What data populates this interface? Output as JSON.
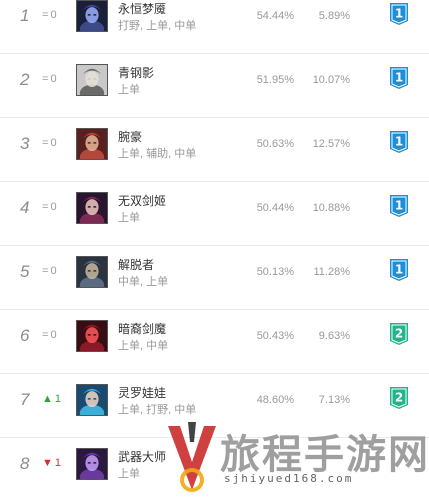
{
  "colors": {
    "tier1": "#1c8fd6",
    "tier2": "#21b58b",
    "up": "#2aa637",
    "down": "#d23030"
  },
  "rows": [
    {
      "rank": "1",
      "change_symbol": "=",
      "change_value": "0",
      "trend": "same",
      "name": "永恒梦魇",
      "roles": "打野, 上单, 中单",
      "win_rate": "54.44%",
      "pick_rate": "5.89%",
      "tier": "1",
      "avatar": "nocturne-avatar"
    },
    {
      "rank": "2",
      "change_symbol": "=",
      "change_value": "0",
      "trend": "same",
      "name": "青钢影",
      "roles": "上单",
      "win_rate": "51.95%",
      "pick_rate": "10.07%",
      "tier": "1",
      "avatar": "camille-avatar"
    },
    {
      "rank": "3",
      "change_symbol": "=",
      "change_value": "0",
      "trend": "same",
      "name": "腕豪",
      "roles": "上单, 辅助, 中单",
      "win_rate": "50.63%",
      "pick_rate": "12.57%",
      "tier": "1",
      "avatar": "sett-avatar"
    },
    {
      "rank": "4",
      "change_symbol": "=",
      "change_value": "0",
      "trend": "same",
      "name": "无双剑姬",
      "roles": "上单",
      "win_rate": "50.44%",
      "pick_rate": "10.88%",
      "tier": "1",
      "avatar": "fiora-avatar"
    },
    {
      "rank": "5",
      "change_symbol": "=",
      "change_value": "0",
      "trend": "same",
      "name": "解脱者",
      "roles": "中单, 上单",
      "win_rate": "50.13%",
      "pick_rate": "11.28%",
      "tier": "1",
      "avatar": "sylas-avatar"
    },
    {
      "rank": "6",
      "change_symbol": "=",
      "change_value": "0",
      "trend": "same",
      "name": "暗裔剑魔",
      "roles": "上单, 中单",
      "win_rate": "50.43%",
      "pick_rate": "9.63%",
      "tier": "2",
      "avatar": "aatrox-avatar"
    },
    {
      "rank": "7",
      "change_symbol": "▲",
      "change_value": "1",
      "trend": "up",
      "name": "灵罗娃娃",
      "roles": "上单, 打野, 中单",
      "win_rate": "48.60%",
      "pick_rate": "7.13%",
      "tier": "2",
      "avatar": "gwen-avatar"
    },
    {
      "rank": "8",
      "change_symbol": "▼",
      "change_value": "1",
      "trend": "down",
      "name": "武器大师",
      "roles": "上单",
      "win_rate": "",
      "pick_rate": "",
      "tier": "",
      "avatar": "jax-avatar"
    }
  ],
  "watermark": {
    "text": "旅程手游网",
    "url": "sjhiyued168.com"
  }
}
